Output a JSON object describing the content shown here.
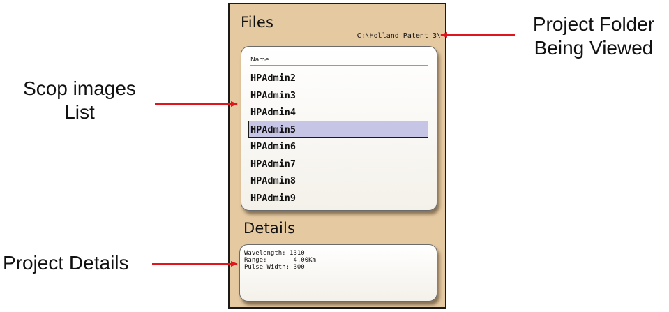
{
  "annotations": {
    "folder": [
      "Project Folder",
      "Being Viewed"
    ],
    "list": [
      "Scop images",
      "List"
    ],
    "details": "Project Details",
    "arrow_color": "#e0161e"
  },
  "files": {
    "title": "Files",
    "folder_path": "C:\\Holland Patent 3\\",
    "column_header": "Name",
    "items": [
      "HPAdmin2",
      "HPAdmin3",
      "HPAdmin4",
      "HPAdmin5",
      "HPAdmin6",
      "HPAdmin7",
      "HPAdmin8",
      "HPAdmin9"
    ],
    "selected": "HPAdmin5"
  },
  "details": {
    "title": "Details",
    "rows": [
      "Wavelength: 1310",
      "Range:       4.00Km",
      "Pulse Width: 300"
    ]
  },
  "colors": {
    "panel_background": "#e4c9a1",
    "selection_fill": "#c7c5e6"
  }
}
